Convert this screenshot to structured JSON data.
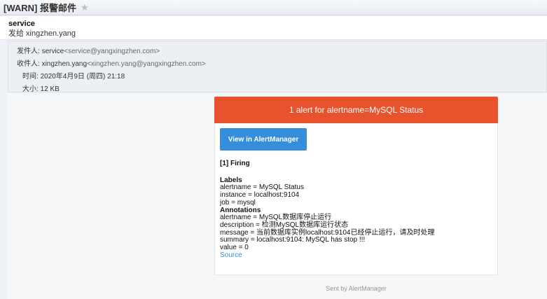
{
  "subject": "[WARN] 报警邮件",
  "sender": {
    "name": "service",
    "to_line": "发给 xingzhen.yang"
  },
  "meta": {
    "from_label": "发件人:",
    "from_name": "service",
    "from_addr": "<service@yangxingzhen.com>",
    "to_label": "收件人:",
    "to_name": "xingzhen.yang",
    "to_addr": "<xingzhen.yang@yangxingzhen.com>",
    "time_label": "时间:",
    "time_value": "2020年4月9日 (周四) 21:18",
    "size_label": "大小:",
    "size_value": "12 KB"
  },
  "alert": {
    "header": "1 alert for alertname=MySQL Status",
    "button": "View in AlertManager",
    "firing": "[1] Firing",
    "labels_title": "Labels",
    "labels": [
      "alertname = MySQL Status",
      "instance = localhost:9104",
      "job = mysql"
    ],
    "annotations_title": "Annotations",
    "annotations": [
      "alertname = MySQL数据库停止运行",
      "description = 检测MySQL数据库运行状态",
      "message = 当前数据库实例localhost:9104已经停止运行，请及时处理",
      "summary = localhost:9104: MySQL has stop !!!",
      "value = 0"
    ],
    "source": "Source",
    "footer": "Sent by AlertManager"
  },
  "colors": {
    "header_bg": "#e8532e",
    "button_bg": "#348eda",
    "link": "#348eda"
  },
  "icons": {
    "star": "star-icon"
  }
}
